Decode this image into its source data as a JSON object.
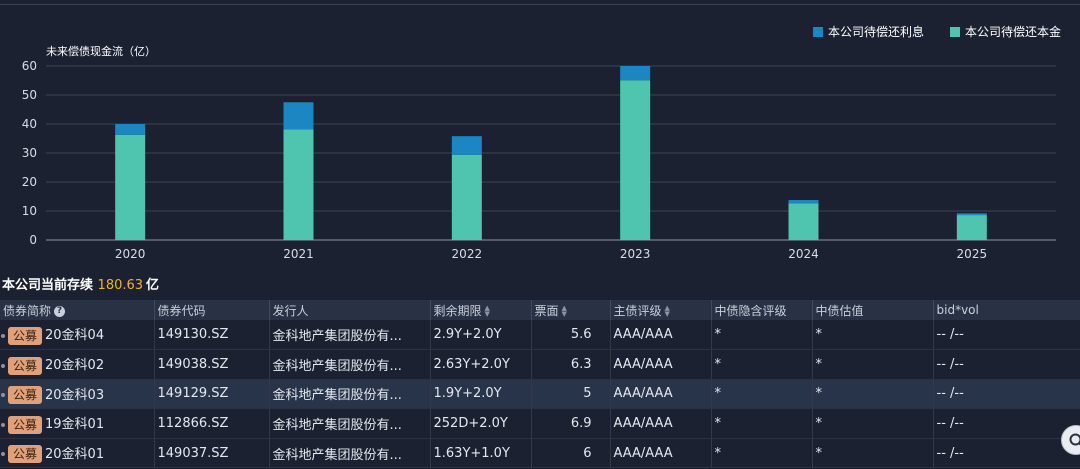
{
  "chart_data": {
    "type": "bar",
    "title": "未来偿债现金流（亿）",
    "categories": [
      "2020",
      "2021",
      "2022",
      "2023",
      "2024",
      "2025"
    ],
    "series": [
      {
        "name": "本公司待偿还本金",
        "values": [
          36.3,
          38.1,
          29.4,
          55.1,
          12.6,
          8.6
        ]
      },
      {
        "name": "本公司待偿还利息",
        "values": [
          3.7,
          9.4,
          6.4,
          4.9,
          1.2,
          0.6
        ]
      }
    ],
    "ylim": [
      0,
      60
    ],
    "yticks": [
      0,
      10,
      20,
      30,
      40,
      50,
      60
    ],
    "stacked": true,
    "grid": true,
    "legend": "top-right",
    "colors": {
      "本公司待偿还本金": "#4fc4ae",
      "本公司待偿还利息": "#1b86c2"
    }
  },
  "summary": {
    "label": "本公司当前存续",
    "amount": "180.63",
    "unit": "亿"
  },
  "table": {
    "columns": [
      "债券简称",
      "债券代码",
      "发行人",
      "剩余期限",
      "票面",
      "主债评级",
      "中债隐含评级",
      "中债估值",
      "bid*vol"
    ],
    "rows": [
      {
        "badge": "公募",
        "name": "20金科04",
        "code": "149130.SZ",
        "issuer": "金科地产集团股份有...",
        "term": "2.9Y+2.0Y",
        "coupon": "5.6",
        "rating": "AAA/AAA",
        "implied": "*",
        "valuation": "*",
        "bidvol": "-- /--"
      },
      {
        "badge": "公募",
        "name": "20金科02",
        "code": "149038.SZ",
        "issuer": "金科地产集团股份有...",
        "term": "2.63Y+2.0Y",
        "coupon": "6.3",
        "rating": "AAA/AAA",
        "implied": "*",
        "valuation": "*",
        "bidvol": "-- /--"
      },
      {
        "badge": "公募",
        "name": "20金科03",
        "code": "149129.SZ",
        "issuer": "金科地产集团股份有...",
        "term": "1.9Y+2.0Y",
        "coupon": "5",
        "rating": "AAA/AAA",
        "implied": "*",
        "valuation": "*",
        "bidvol": "-- /--"
      },
      {
        "badge": "公募",
        "name": "19金科01",
        "code": "112866.SZ",
        "issuer": "金科地产集团股份有...",
        "term": "252D+2.0Y",
        "coupon": "6.9",
        "rating": "AAA/AAA",
        "implied": "*",
        "valuation": "*",
        "bidvol": "-- /--"
      },
      {
        "badge": "公募",
        "name": "20金科01",
        "code": "149037.SZ",
        "issuer": "金科地产集团股份有...",
        "term": "1.63Y+1.0Y",
        "coupon": "6",
        "rating": "AAA/AAA",
        "implied": "*",
        "valuation": "*",
        "bidvol": "-- /--"
      }
    ]
  },
  "icons": {
    "search": "search-icon",
    "help": "help-icon"
  }
}
